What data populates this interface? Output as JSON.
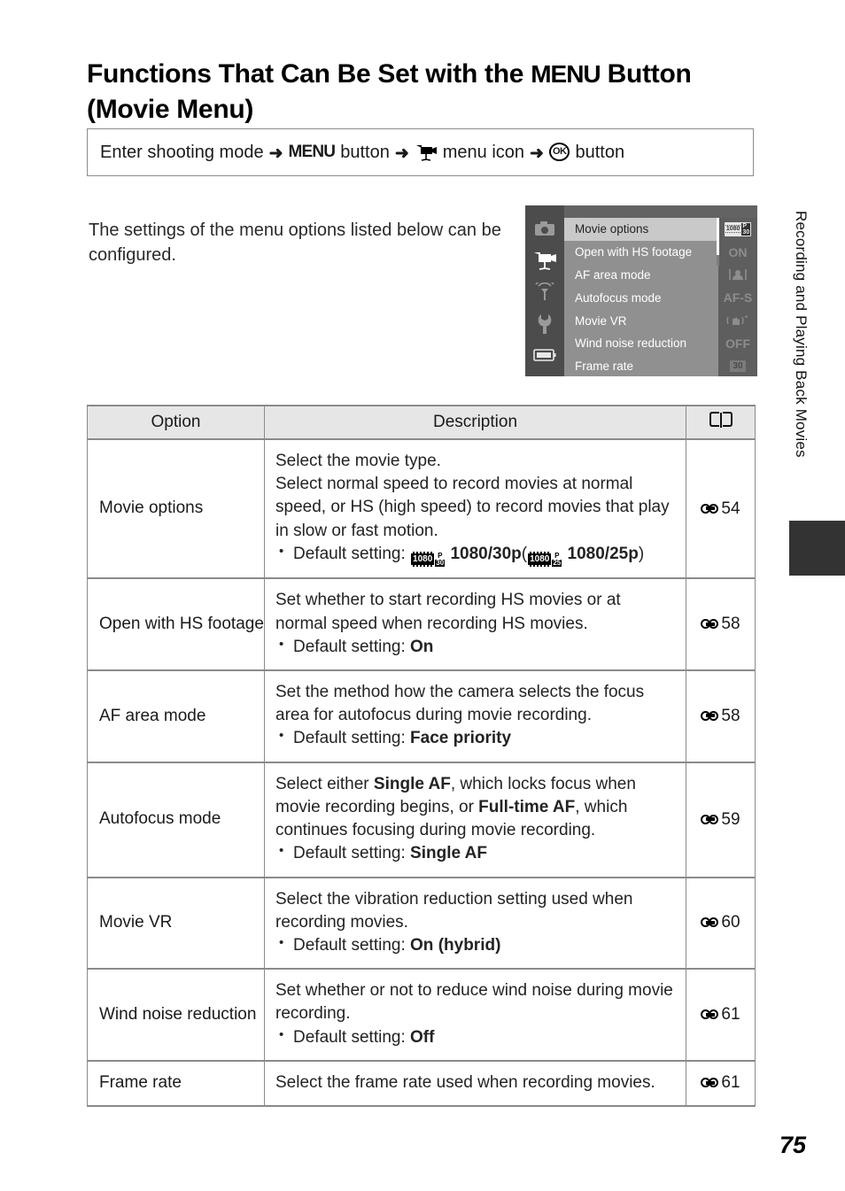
{
  "page": {
    "number": "75",
    "side_tab_label": "Recording and Playing Back Movies"
  },
  "title": {
    "line1_before": "Functions That Can Be Set with the ",
    "line1_menu": "MENU",
    "line1_after": " Button",
    "line2": "(Movie Menu)"
  },
  "nav_path": {
    "step1": "Enter shooting mode",
    "arrow": "➜",
    "step2_menu": "MENU",
    "step2_suffix": " button",
    "step3_icon": "movie-camera-icon",
    "step3": "menu icon",
    "step4_ok": "OK",
    "step4_suffix": " button"
  },
  "intro": "The settings of the menu options listed below can be configured.",
  "lcd": {
    "rail_icons": [
      "camera-icon",
      "movie-camera-icon",
      "wireless-icon",
      "wrench-icon",
      "battery-icon"
    ],
    "active_rail_index": 1,
    "rows": [
      {
        "label": "Movie options",
        "value": "1080/30p",
        "value_type": "film-badge",
        "selected": true
      },
      {
        "label": "Open with HS footage",
        "value": "ON",
        "value_type": "text",
        "selected": false
      },
      {
        "label": "AF area mode",
        "value": "face-icon",
        "value_type": "icon",
        "selected": false
      },
      {
        "label": "Autofocus mode",
        "value": "AF-S",
        "value_type": "text",
        "selected": false
      },
      {
        "label": "Movie VR",
        "value": "vr-icon",
        "value_type": "icon",
        "selected": false
      },
      {
        "label": "Wind noise reduction",
        "value": "OFF",
        "value_type": "text",
        "selected": false
      },
      {
        "label": "Frame rate",
        "value": "30",
        "value_type": "badge",
        "selected": false
      }
    ]
  },
  "table": {
    "headers": {
      "option": "Option",
      "description": "Description",
      "reference": "book-icon"
    },
    "rows": [
      {
        "option": "Movie options",
        "desc_lines": [
          "Select the movie type.",
          "Select normal speed to record movies at normal speed, or HS (high speed) to record movies that play in slow or fast motion."
        ],
        "bullet_prefix": "Default setting: ",
        "bullet_value": "1080/30p",
        "bullet_alt": "1080/25p",
        "reference": "54"
      },
      {
        "option": "Open with HS footage",
        "desc_lines": [
          "Set whether to start recording HS movies or at normal speed when recording HS movies."
        ],
        "bullet_prefix": "Default setting: ",
        "bullet_value": "On",
        "reference": "58"
      },
      {
        "option": "AF area mode",
        "desc_lines": [
          "Set the method how the camera selects the focus area for autofocus during movie recording."
        ],
        "bullet_prefix": "Default setting: ",
        "bullet_value": "Face priority",
        "reference": "58"
      },
      {
        "option": "Autofocus mode",
        "desc_lines": [
          "Select either Single AF, which locks focus when movie recording begins, or Full-time AF, which continues focusing during movie recording."
        ],
        "bullet_prefix": "Default setting: ",
        "bullet_value": "Single AF",
        "reference": "59"
      },
      {
        "option": "Movie VR",
        "desc_lines": [
          "Select the vibration reduction setting used when recording movies."
        ],
        "bullet_prefix": "Default setting: ",
        "bullet_value": "On (hybrid)",
        "reference": "60"
      },
      {
        "option": "Wind noise reduction",
        "desc_lines": [
          "Set whether or not to reduce wind noise during movie recording."
        ],
        "bullet_prefix": "Default setting: ",
        "bullet_value": "Off",
        "reference": "61"
      },
      {
        "option": "Frame rate",
        "desc_lines": [
          "Select the frame rate used when recording movies."
        ],
        "reference": "61"
      }
    ]
  },
  "colors": {
    "lcd_background": "#636363",
    "lcd_rail": "#4c4c4c",
    "lcd_list": "#909090",
    "lcd_selected": "#c9c9c9",
    "table_header_bg": "#e6e6e6",
    "table_border": "#8a8a8a",
    "side_tab": "#333333"
  }
}
